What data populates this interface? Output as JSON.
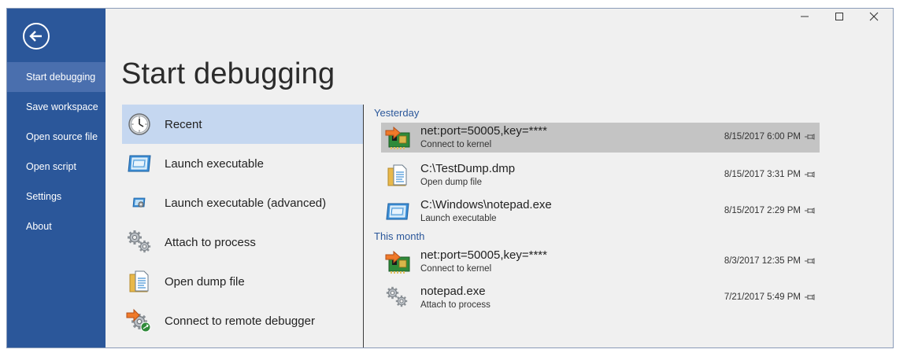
{
  "sidebar": {
    "items": [
      {
        "label": "Start debugging"
      },
      {
        "label": "Save workspace"
      },
      {
        "label": "Open source file"
      },
      {
        "label": "Open script"
      },
      {
        "label": "Settings"
      },
      {
        "label": "About"
      }
    ],
    "selected_index": 0
  },
  "page": {
    "title": "Start debugging"
  },
  "actions": [
    {
      "label": "Recent",
      "icon": "clock-icon"
    },
    {
      "label": "Launch executable",
      "icon": "window-icon"
    },
    {
      "label": "Launch executable (advanced)",
      "icon": "window-gear-icon"
    },
    {
      "label": "Attach to process",
      "icon": "gears-icon"
    },
    {
      "label": "Open dump file",
      "icon": "document-icon"
    },
    {
      "label": "Connect to remote debugger",
      "icon": "remote-connect-icon"
    }
  ],
  "recent": {
    "yesterday_label": "Yesterday",
    "this_month_label": "This month",
    "items": [
      {
        "name": "net:port=50005,key=****",
        "sub": "Connect to kernel",
        "date": "8/15/2017 6:00 PM",
        "icon": "network-card-icon"
      },
      {
        "name": "C:\\TestDump.dmp",
        "sub": "Open dump file",
        "date": "8/15/2017 3:31 PM",
        "icon": "document-icon"
      },
      {
        "name": "C:\\Windows\\notepad.exe",
        "sub": "Launch executable",
        "date": "8/15/2017 2:29 PM",
        "icon": "window-icon"
      },
      {
        "name": "net:port=50005,key=****",
        "sub": "Connect to kernel",
        "date": "8/3/2017 12:35 PM",
        "icon": "network-card-icon"
      },
      {
        "name": "notepad.exe",
        "sub": "Attach to process",
        "date": "7/21/2017 5:49 PM",
        "icon": "gears-icon"
      }
    ]
  },
  "colors": {
    "sidebar_bg": "#2b579a",
    "sidebar_selected": "#4a6fae",
    "action_selected": "#c5d7f0",
    "recent_selected": "#c4c4c4",
    "group_header": "#2b579a"
  }
}
